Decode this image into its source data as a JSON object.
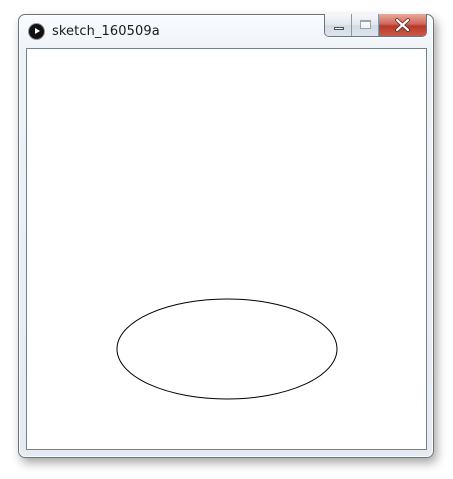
{
  "window": {
    "title": "sketch_160509a",
    "app_icon": "processing-play-icon"
  },
  "caption_buttons": {
    "minimize_icon": "minimize-icon",
    "maximize_icon": "maximize-icon",
    "close_icon": "close-icon"
  },
  "sketch": {
    "background": "#ffffff",
    "stroke": "#000000",
    "fill": "#ffffff",
    "shape": "ellipse"
  }
}
